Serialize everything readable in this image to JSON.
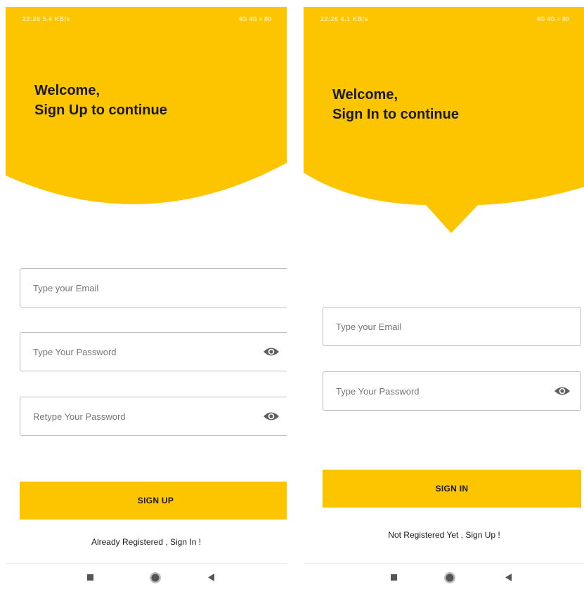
{
  "colors": {
    "accent": "#fdc500",
    "text": "#1a1a1a",
    "field_border": "#bdbdbd",
    "placeholder": "#757575"
  },
  "signup_screen": {
    "status_left": "22:26 5.4 KB/s",
    "status_right": "4G 4G ≈ 80",
    "welcome_line1": "Welcome,",
    "welcome_line2": "Sign Up to continue",
    "email_placeholder": "Type your Email",
    "password_placeholder": "Type Your Password",
    "retype_placeholder": "Retype Your Password",
    "button_label": "SIGN UP",
    "switch_text": "Already Registered , Sign In !"
  },
  "signin_screen": {
    "status_left": "22:26 4.1 KB/s",
    "status_right": "4G 4G ≈ 80",
    "welcome_line1": "Welcome,",
    "welcome_line2": "Sign In to continue",
    "email_placeholder": "Type your Email",
    "password_placeholder": "Type Your Password",
    "button_label": "SIGN IN",
    "switch_text": "Not Registered Yet , Sign Up !"
  },
  "icons": {
    "password_toggle": "eye-icon",
    "nav_recent": "square-icon",
    "nav_home": "circle-icon",
    "nav_back": "triangle-back-icon"
  }
}
